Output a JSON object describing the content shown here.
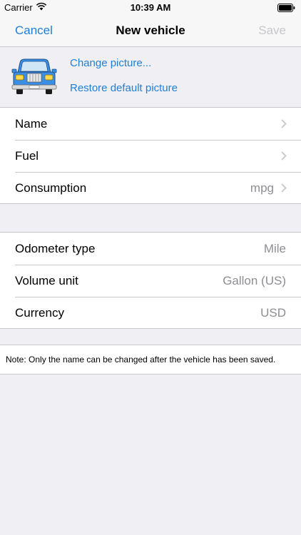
{
  "status_bar": {
    "carrier": "Carrier",
    "time": "10:39 AM",
    "icons": [
      "wifi-icon",
      "battery-icon"
    ]
  },
  "nav": {
    "cancel": "Cancel",
    "title": "New vehicle",
    "save": "Save"
  },
  "picture": {
    "icon": "car-icon",
    "change": "Change picture...",
    "restore": "Restore default picture"
  },
  "vehicle_fields": [
    {
      "label": "Name",
      "value": ""
    },
    {
      "label": "Fuel",
      "value": ""
    },
    {
      "label": "Consumption",
      "value": "mpg"
    }
  ],
  "unit_fields": [
    {
      "label": "Odometer type",
      "value": "Mile"
    },
    {
      "label": "Volume unit",
      "value": "Gallon (US)"
    },
    {
      "label": "Currency",
      "value": "USD"
    }
  ],
  "note": "Note: Only the name can be changed after the vehicle has been saved.",
  "colors": {
    "accent": "#1f7fdb",
    "disabled": "#c7c7cc",
    "secondary_text": "#8e8e93",
    "background": "#efeff4",
    "car_body": "#3a8ee6"
  }
}
